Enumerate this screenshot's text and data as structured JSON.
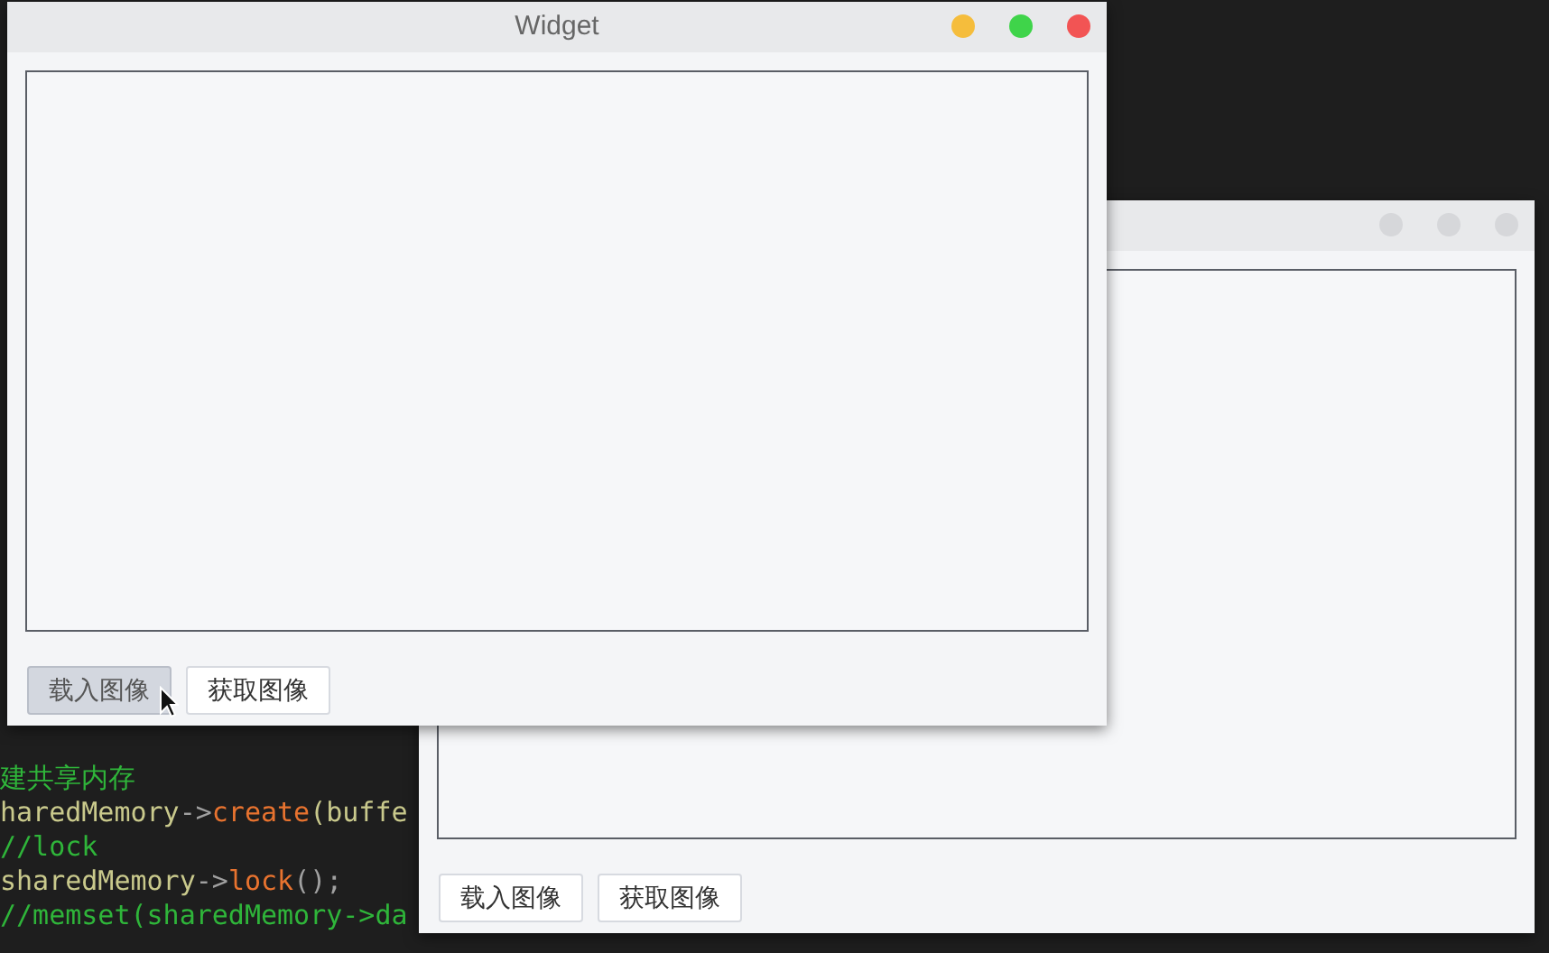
{
  "code_lines": [
    {
      "tokens": [
        {
          "kind": "comment",
          "text": "建共享内存"
        }
      ]
    },
    {
      "tokens": [
        {
          "kind": "identifier",
          "text": "haredMemory"
        },
        {
          "kind": "operator",
          "text": "->"
        },
        {
          "kind": "function",
          "text": "create"
        },
        {
          "kind": "identifier",
          "text": "(buffe"
        }
      ]
    },
    {
      "tokens": [
        {
          "kind": "comment",
          "text": "//lock"
        }
      ]
    },
    {
      "tokens": [
        {
          "kind": "identifier",
          "text": "sharedMemory"
        },
        {
          "kind": "operator",
          "text": "->"
        },
        {
          "kind": "function",
          "text": "lock"
        },
        {
          "kind": "operator",
          "text": "();"
        }
      ]
    },
    {
      "tokens": [
        {
          "kind": "comment",
          "text": "//memset(sharedMemory->da"
        }
      ]
    }
  ],
  "windows": [
    {
      "active": false,
      "buttons": [
        {
          "label": "载入图像",
          "pressed": false
        },
        {
          "label": "获取图像",
          "pressed": false
        }
      ]
    },
    {
      "title": "Widget",
      "active": true,
      "buttons": [
        {
          "label": "载入图像",
          "pressed": true
        },
        {
          "label": "获取图像",
          "pressed": false
        }
      ]
    }
  ]
}
